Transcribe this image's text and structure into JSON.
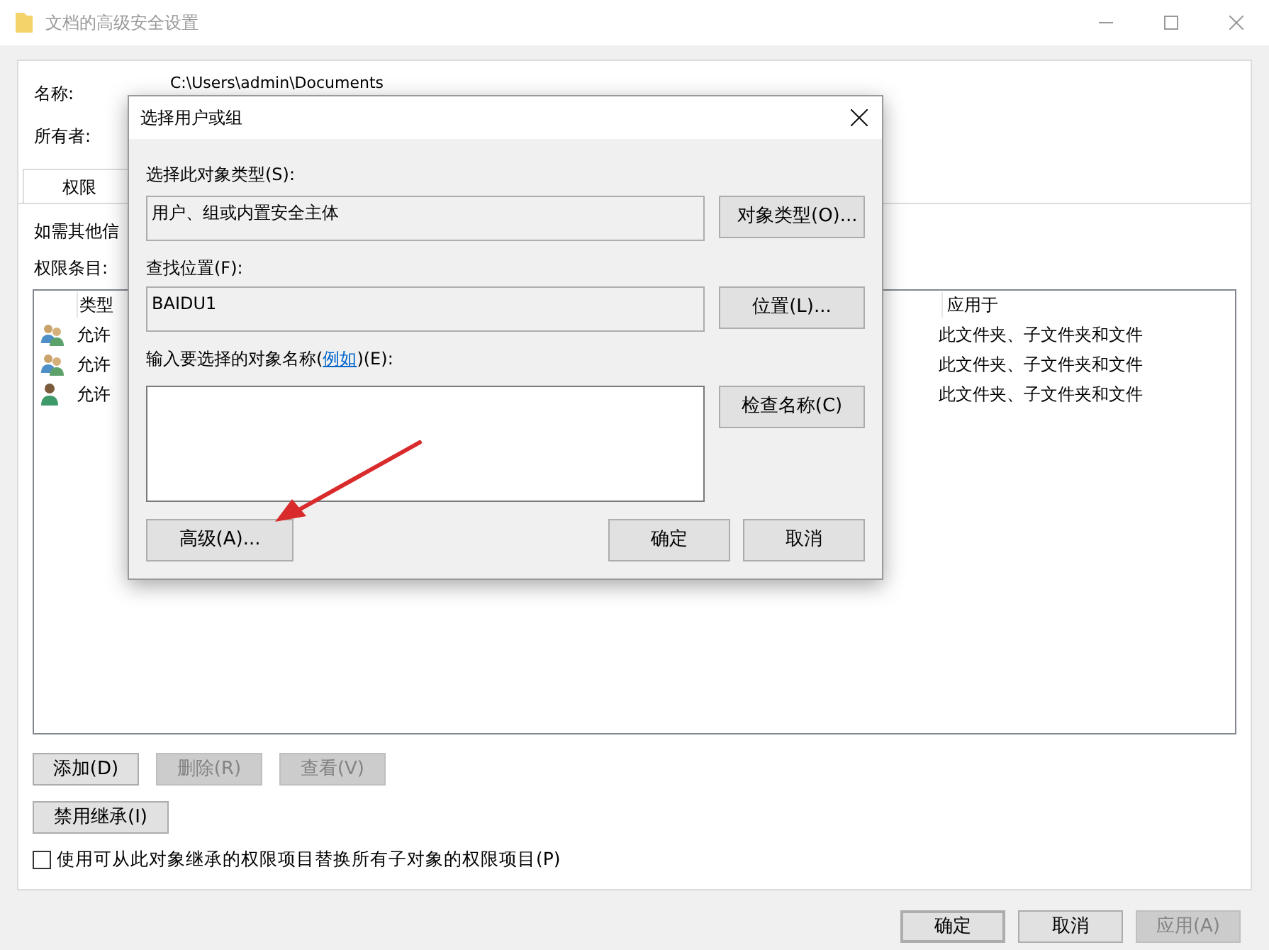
{
  "window": {
    "title": "文档的高级安全设置"
  },
  "name_label": "名称:",
  "name_value": "C:\\Users\\admin\\Documents",
  "owner_label": "所有者:",
  "tabs": [
    {
      "label": "权限",
      "selected": true
    }
  ],
  "info_text": "如需其他信",
  "entries_label": "权限条目:",
  "table": {
    "columns": [
      "类型",
      "应用于"
    ],
    "rows": [
      {
        "kind": "group",
        "type": "允许",
        "applies_to": "此文件夹、子文件夹和文件"
      },
      {
        "kind": "group",
        "type": "允许",
        "applies_to": "此文件夹、子文件夹和文件"
      },
      {
        "kind": "user",
        "type": "允许",
        "applies_to": "此文件夹、子文件夹和文件"
      }
    ]
  },
  "entry_buttons": [
    {
      "label": "添加(D)",
      "disabled": false
    },
    {
      "label": "删除(R)",
      "disabled": true
    },
    {
      "label": "查看(V)",
      "disabled": true
    }
  ],
  "inherit_button": "禁用继承(I)",
  "replace_checkbox": {
    "label": "使用可从此对象继承的权限项目替换所有子对象的权限项目(P)",
    "checked": false
  },
  "footer_buttons": [
    {
      "label": "确定",
      "disabled": false,
      "default": true
    },
    {
      "label": "取消",
      "disabled": false,
      "default": false
    },
    {
      "label": "应用(A)",
      "disabled": true,
      "default": false
    }
  ],
  "dialog": {
    "title": "选择用户或组",
    "type_label": "选择此对象类型(S):",
    "type_value": "用户、组或内置安全主体",
    "type_button": "对象类型(O)...",
    "location_label": "查找位置(F):",
    "location_value": "BAIDU1",
    "location_button": "位置(L)...",
    "names_label_before": "输入要选择的对象名称(",
    "names_link": "例如",
    "names_label_after": ")(E):",
    "check_button": "检查名称(C)",
    "advanced_button": "高级(A)...",
    "ok_button": "确定",
    "cancel_button": "取消"
  }
}
